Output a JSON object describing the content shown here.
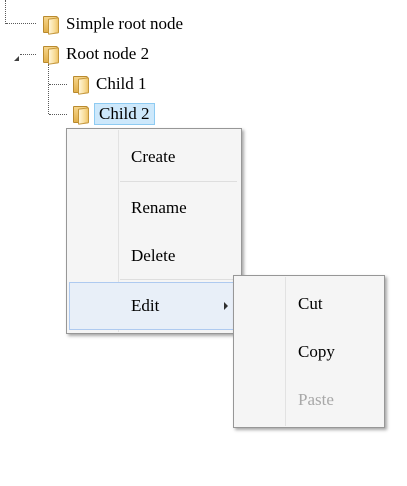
{
  "tree": {
    "nodes": [
      {
        "label": "Simple root node",
        "icon": "folder-icon"
      },
      {
        "label": "Root node 2",
        "icon": "folder-icon",
        "expanded": true
      },
      {
        "label": "Child 1",
        "icon": "folder-icon"
      },
      {
        "label": "Child 2",
        "icon": "folder-icon",
        "selected": true
      }
    ]
  },
  "context_menu": {
    "items": [
      "Create",
      "Rename",
      "Delete",
      "Edit"
    ]
  },
  "edit_submenu": {
    "items": [
      "Cut",
      "Copy",
      "Paste"
    ],
    "disabled": [
      "Paste"
    ]
  },
  "colors": {
    "selection_bg": "#cde8fb",
    "selection_border": "#8ecbf2",
    "menu_bg": "#f5f5f5",
    "menu_hover_bg": "#e8eff8",
    "disabled_text": "#a8a8a8"
  }
}
